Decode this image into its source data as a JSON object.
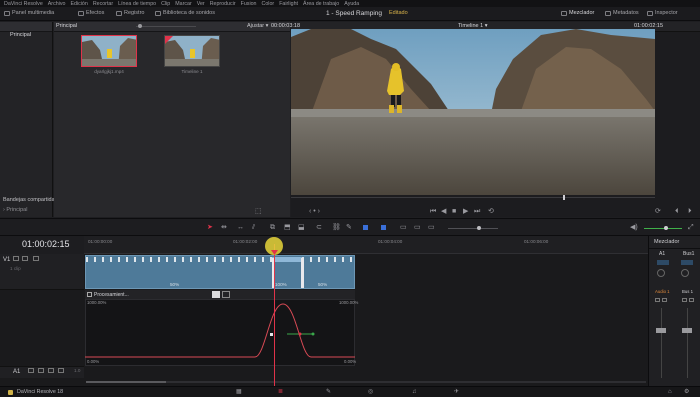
{
  "menu": [
    "DaVinci Resolve",
    "Archivo",
    "Edición",
    "Recortar",
    "Línea de tiempo",
    "Clip",
    "Marcar",
    "Ver",
    "Reproducir",
    "Fusion",
    "Color",
    "Fairlight",
    "Área de trabajo",
    "Ayuda"
  ],
  "toolbar": {
    "media_pool": "Panel multimedia",
    "effects": "Efectos",
    "index": "Registro",
    "sound_library": "Biblioteca de sonidos",
    "project_title": "1 - Speed Ramping",
    "project_status": "Editado",
    "mixer": "Mezclador",
    "metadata": "Metadatos",
    "inspector": "Inspector"
  },
  "left_panel": {
    "master": "Principal",
    "shared_bins": "Bandejas compartidas",
    "shared_master": "Principal"
  },
  "media_pool": {
    "bin_title": "Principal",
    "clips": [
      {
        "label": "dyarlgjkj1.mp4"
      },
      {
        "label": "Timeline 1"
      }
    ]
  },
  "viewer": {
    "zoom": "Ajustar",
    "source_tc": "00:00:03:18",
    "timeline_name": "Timeline 1",
    "record_tc": "01:00:02:15"
  },
  "timeline": {
    "timecode": "01:00:02:15",
    "ruler": [
      "01:00:00:00",
      "01:00:02:00",
      "01:00:04:00",
      "01:00:06:00"
    ],
    "track_v1": "V1",
    "track_a1": "A1",
    "v1_label": "1 clip",
    "speed_labels": [
      "50%",
      "100%",
      "50%"
    ],
    "retime_name": "Procesamient...",
    "curve_max_left": "1000.00%",
    "curve_max_right": "1000.00%",
    "curve_min_left": "0.00%",
    "curve_min_right": "0.00%",
    "a1_value": "1.0"
  },
  "mixer": {
    "title": "Mezclador",
    "ch1": "A1",
    "ch2": "Bus1",
    "ch1_label": "Audio 1",
    "ch2_label": "Bus 1"
  },
  "bottom": {
    "app": "DaVinci Resolve 18"
  },
  "colors": {
    "accent_orange": "#e08a3c",
    "playhead_red": "#e0334a",
    "clip_blue": "#4e7a99",
    "curve_red": "#d94a55",
    "highlight_yellow": "#e8d63a"
  }
}
